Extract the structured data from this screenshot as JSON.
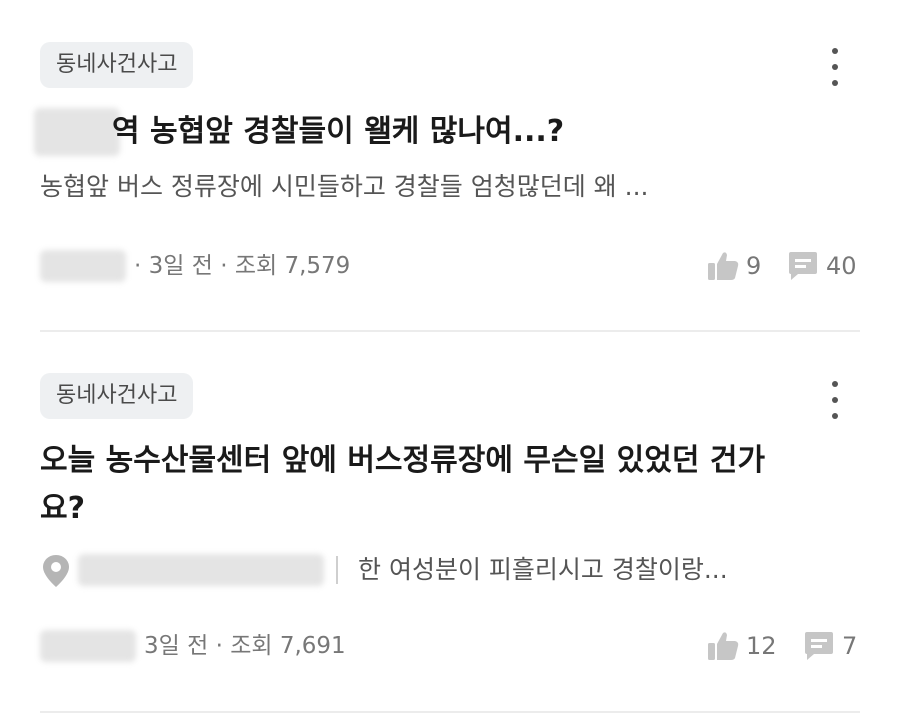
{
  "posts": [
    {
      "tag": "동네사건사고",
      "title": "역 농협앞 경찰들이 왤케 많나여...?",
      "preview": "농협앞 버스 정류장에 시민들하고 경찰들 엄청많던데 왜 ...",
      "meta": "· 3일 전 · 조회 7,579",
      "likes": "9",
      "comments": "40"
    },
    {
      "tag": "동네사건사고",
      "title": "오늘 농수산물센터 앞에 버스정류장에 무슨일 있었던 건가요?",
      "preview": "한 여성분이 피흘리시고 경찰이랑...",
      "meta": "3일 전 · 조회 7,691",
      "likes": "12",
      "comments": "7"
    }
  ],
  "icons": {
    "more": "more-vertical-icon",
    "like": "thumbs-up-icon",
    "comment": "comment-icon",
    "location": "location-pin-icon"
  }
}
